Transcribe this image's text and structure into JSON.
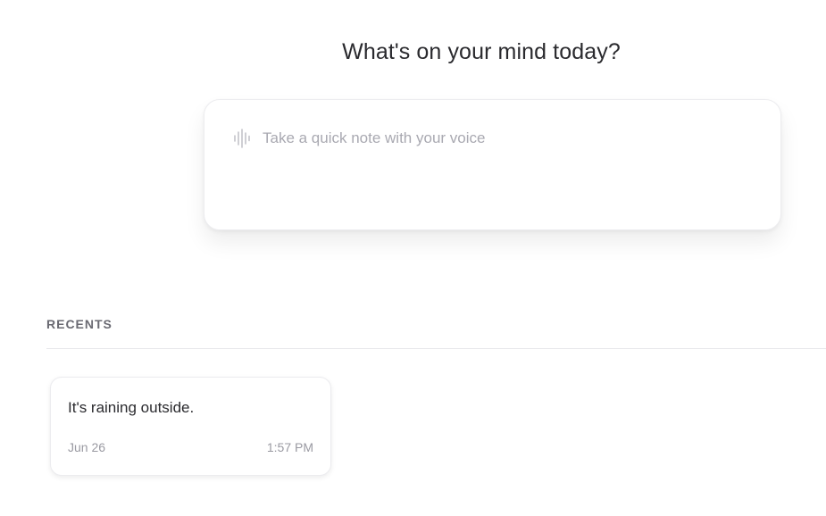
{
  "header": {
    "title": "What's on your mind today?"
  },
  "composer": {
    "placeholder": "Take a quick note with your voice",
    "icon": "voice-waveform-icon"
  },
  "recents": {
    "label": "RECENTS",
    "items": [
      {
        "text": "It's raining outside.",
        "date": "Jun 26",
        "time": "1:57 PM"
      }
    ]
  }
}
